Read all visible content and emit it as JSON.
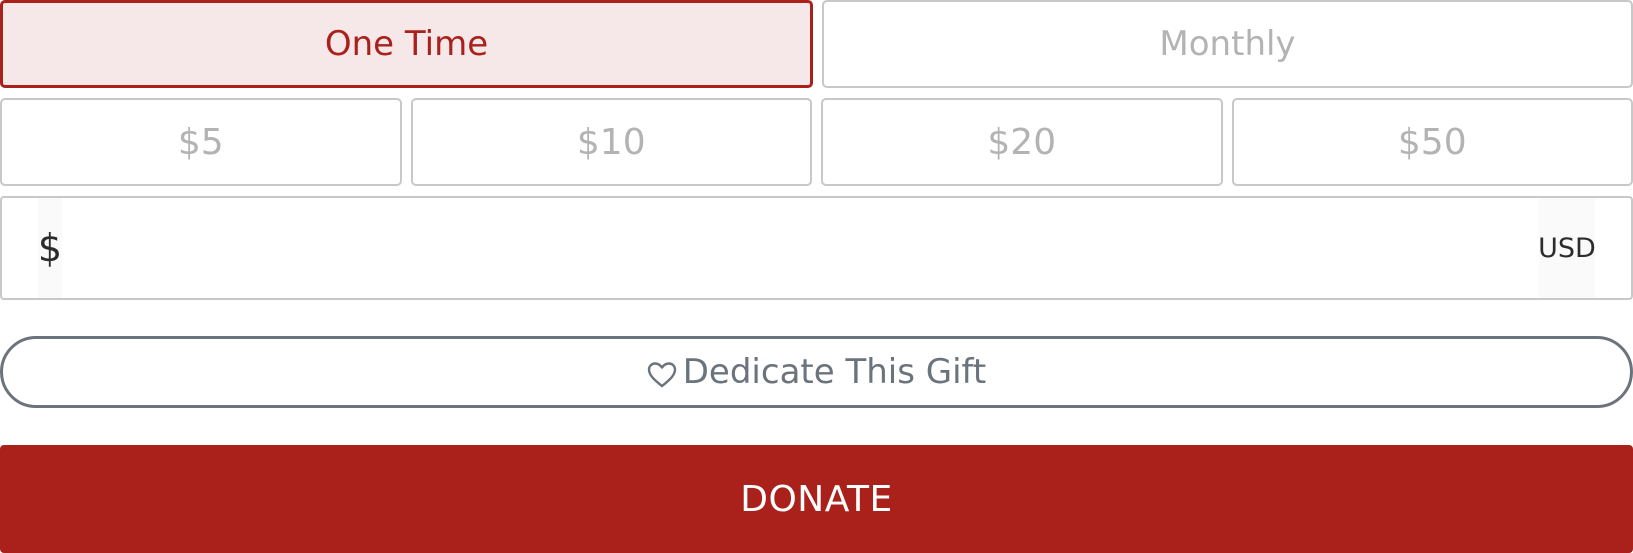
{
  "frequency": {
    "options": [
      {
        "label": "One Time",
        "selected": true
      },
      {
        "label": "Monthly",
        "selected": false
      }
    ]
  },
  "amounts": {
    "options": [
      "$5",
      "$10",
      "$20",
      "$50"
    ]
  },
  "custom_amount": {
    "currency_symbol": "$",
    "value": "",
    "currency_code": "USD"
  },
  "dedicate": {
    "label": "Dedicate This Gift",
    "icon": "heart-outline-icon"
  },
  "donate": {
    "label": "DONATE"
  },
  "colors": {
    "accent": "#aa211b",
    "accent_tint": "#f6e8e8",
    "muted_text": "#b3b3b3",
    "border": "#c8c8c8",
    "dedicate_gray": "#6b737c"
  }
}
